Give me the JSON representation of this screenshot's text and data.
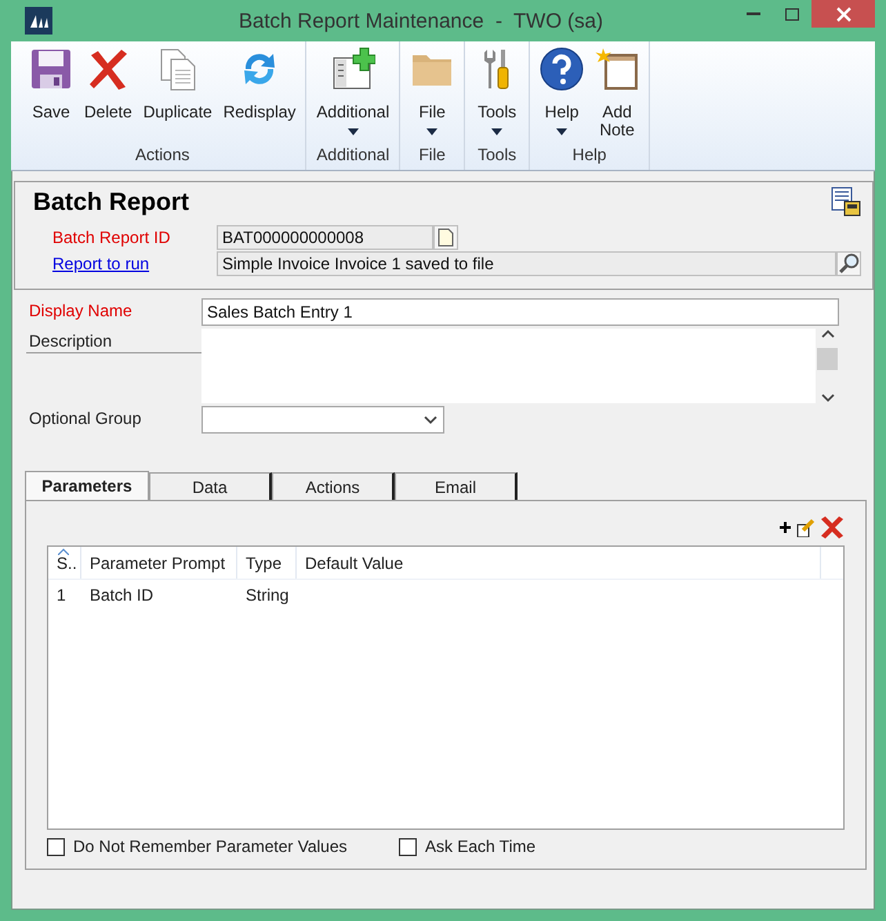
{
  "window": {
    "title": "Batch Report Maintenance  -  TWO (sa)"
  },
  "ribbon": {
    "groups": [
      {
        "label": "Actions",
        "buttons": [
          {
            "label": "Save",
            "kind": "save",
            "dropdown": false
          },
          {
            "label": "Delete",
            "kind": "delete",
            "dropdown": false
          },
          {
            "label": "Duplicate",
            "kind": "duplicate",
            "dropdown": false
          },
          {
            "label": "Redisplay",
            "kind": "redisplay",
            "dropdown": false
          }
        ]
      },
      {
        "label": "Additional",
        "buttons": [
          {
            "label": "Additional",
            "kind": "additional",
            "dropdown": true
          }
        ]
      },
      {
        "label": "File",
        "buttons": [
          {
            "label": "File",
            "kind": "file",
            "dropdown": true
          }
        ]
      },
      {
        "label": "Tools",
        "buttons": [
          {
            "label": "Tools",
            "kind": "tools",
            "dropdown": true
          }
        ]
      },
      {
        "label": "Help",
        "buttons": [
          {
            "label": "Help",
            "kind": "help",
            "dropdown": true
          },
          {
            "label": "Add Note",
            "kind": "note",
            "dropdown": false
          }
        ]
      }
    ]
  },
  "header": {
    "title": "Batch Report",
    "fields": [
      {
        "label": "Batch Report ID",
        "required": true,
        "link": false,
        "kind": "id",
        "value": "BAT000000000008"
      },
      {
        "label": "Report to run",
        "required": false,
        "link": true,
        "kind": "lookup",
        "value": "Simple Invoice Invoice 1 saved to file"
      }
    ]
  },
  "form": [
    {
      "label": "Display Name",
      "required": true,
      "kind": "text",
      "value": "Sales Batch Entry 1"
    },
    {
      "label": "Description",
      "required": false,
      "kind": "textarea"
    },
    {
      "label": "Optional Group",
      "required": false,
      "kind": "dropdown"
    }
  ],
  "tabs": [
    {
      "label": "Parameters",
      "selected": true
    },
    {
      "label": "Data",
      "selected": false
    },
    {
      "label": "Actions",
      "selected": false
    },
    {
      "label": "Email",
      "selected": false
    }
  ],
  "table": {
    "columns": [
      {
        "label": "S..",
        "sorted": true
      },
      {
        "label": "Parameter Prompt",
        "sorted": false
      },
      {
        "label": "Type",
        "sorted": false
      },
      {
        "label": "Default Value",
        "sorted": false
      }
    ],
    "rows": [
      {
        "s": "1",
        "parameter_prompt": "Batch ID",
        "type": "String"
      }
    ]
  },
  "options": [
    {
      "label": "Do Not Remember Parameter Values",
      "checked": false
    },
    {
      "label": "Ask Each Time",
      "checked": false
    }
  ]
}
